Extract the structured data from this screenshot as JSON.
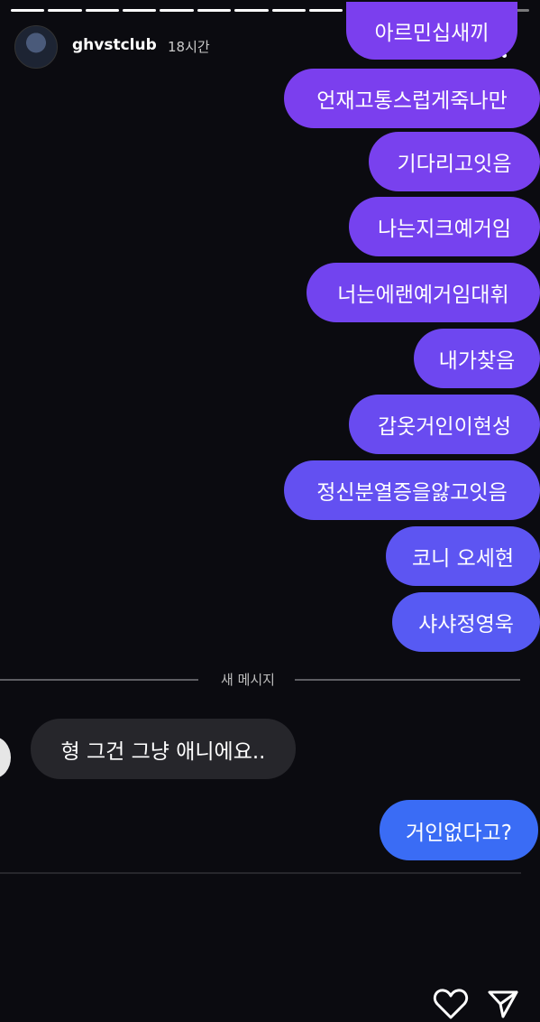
{
  "story": {
    "progress_segments": 14,
    "progress_done": 9
  },
  "header": {
    "username": "ghvstclub",
    "time": "18시간"
  },
  "sent_messages": [
    {
      "text": "아르민십새끼",
      "color": "#7b3fee"
    },
    {
      "text": "언재고통스럽게죽나만",
      "color": "#7b3fee"
    },
    {
      "text": "기다리고잇음",
      "color": "#7941ee"
    },
    {
      "text": "나는지크예거임",
      "color": "#7642ef"
    },
    {
      "text": "너는에랜예거임대휘",
      "color": "#7244ef"
    },
    {
      "text": "내가찾음",
      "color": "#6e47f0"
    },
    {
      "text": "갑옷거인이현성",
      "color": "#694bf0"
    },
    {
      "text": "정신분열증을앓고잇음",
      "color": "#6350f1"
    },
    {
      "text": "코니 오세현",
      "color": "#5d55f2"
    },
    {
      "text": "샤샤정영욱",
      "color": "#575af3"
    }
  ],
  "divider": {
    "label": "새 메시지"
  },
  "received_message": {
    "text": "형 그건 그냥 애니에요.."
  },
  "reply_message": {
    "text": "거인없다고?",
    "color": "#3a6cf5"
  },
  "icons": [
    "heart-icon",
    "send-icon",
    "more-icon"
  ]
}
